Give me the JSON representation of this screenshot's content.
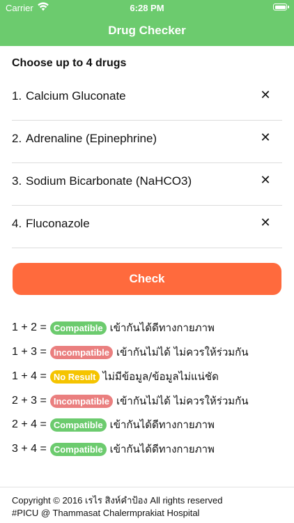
{
  "status_bar": {
    "carrier": "Carrier",
    "time": "6:28 PM",
    "wifi_icon": "wifi-icon",
    "battery_icon": "battery-icon"
  },
  "nav": {
    "title": "Drug Checker"
  },
  "heading": "Choose up to 4 drugs",
  "drugs": [
    {
      "num": "1.",
      "name": "Calcium Gluconate"
    },
    {
      "num": "2.",
      "name": "Adrenaline (Epinephrine)"
    },
    {
      "num": "3.",
      "name": "Sodium Bicarbonate (NaHCO3)"
    },
    {
      "num": "4.",
      "name": "Fluconazole"
    }
  ],
  "clear_glyph": "✕",
  "check_button": "Check",
  "results": [
    {
      "pair": "1 + 2 =",
      "badge": "Compatible",
      "badge_color": "#6ccb6e",
      "desc": "เข้ากันได้ดีทางกายภาพ"
    },
    {
      "pair": "1 + 3 =",
      "badge": "Incompatible",
      "badge_color": "#ea7f7f",
      "desc": "เข้ากันไม่ได้ ไม่ควรให้ร่วมกัน"
    },
    {
      "pair": "1 + 4 =",
      "badge": "No Result",
      "badge_color": "#f5c400",
      "desc": "ไม่มีข้อมูล/ข้อมูลไม่แน่ชัด"
    },
    {
      "pair": "2 + 3 =",
      "badge": "Incompatible",
      "badge_color": "#ea7f7f",
      "desc": "เข้ากันไม่ได้ ไม่ควรให้ร่วมกัน"
    },
    {
      "pair": "2 + 4 =",
      "badge": "Compatible",
      "badge_color": "#6ccb6e",
      "desc": "เข้ากันได้ดีทางกายภาพ"
    },
    {
      "pair": "3 + 4 =",
      "badge": "Compatible",
      "badge_color": "#6ccb6e",
      "desc": "เข้ากันได้ดีทางกายภาพ"
    }
  ],
  "footer": {
    "line1": "Copyright © 2016 เรไร สิงห์คำป้อง All rights reserved",
    "line2": "#PICU @ Thammasat Chalermprakiat Hospital"
  },
  "colors": {
    "nav_green": "#6ccb6e",
    "check_orange": "#ff6a3d"
  }
}
